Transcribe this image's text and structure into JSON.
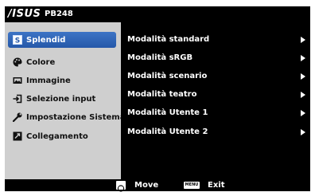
{
  "header": {
    "brand": "/ISUS",
    "model": "PB248"
  },
  "sidebar": {
    "items": [
      {
        "label": "Splendid",
        "icon": "splendid-icon",
        "selected": true
      },
      {
        "label": "Colore",
        "icon": "palette-icon"
      },
      {
        "label": "Immagine",
        "icon": "image-icon"
      },
      {
        "label": "Selezione input",
        "icon": "input-icon"
      },
      {
        "label": "Impostazione Sistema",
        "icon": "wrench-icon"
      },
      {
        "label": "Collegamento",
        "icon": "link-icon"
      }
    ]
  },
  "main": {
    "options": [
      {
        "label": "Modalità standard"
      },
      {
        "label": "Modalità sRGB"
      },
      {
        "label": "Modalità scenario"
      },
      {
        "label": "Modalità teatro"
      },
      {
        "label": "Modalità Utente 1"
      },
      {
        "label": "Modalità Utente 2"
      }
    ]
  },
  "footer": {
    "move_label": "Move",
    "menu_key": "MENU",
    "exit_label": "Exit"
  },
  "colors": {
    "selected": "#2f63b5",
    "sidebar_bg": "#cfcfcf",
    "osd_bg": "#000000"
  }
}
